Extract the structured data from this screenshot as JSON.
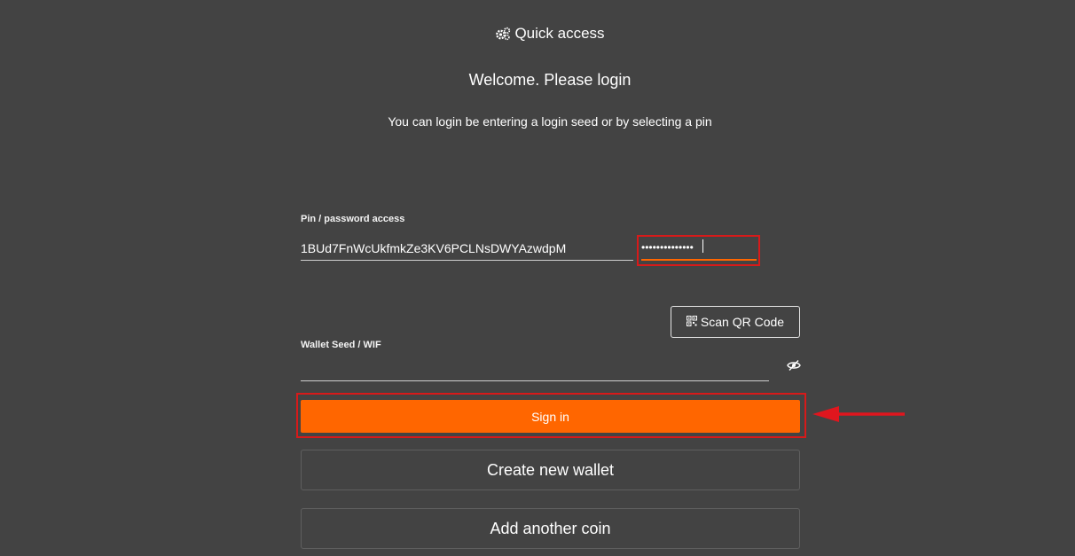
{
  "header": {
    "title": "Quick access",
    "icon": "gears-icon"
  },
  "welcome": "Welcome. Please login",
  "subtitle": "You can login be entering a login seed or by selecting a pin",
  "pin_section": {
    "label": "Pin / password access",
    "address_value": "1BUd7FnWcUkfmkZe3KV6PCLNsDWYAzwdpM",
    "pin_masked": "••••••••••••••"
  },
  "scan_button": {
    "label": "Scan QR Code",
    "icon": "qr-code-icon"
  },
  "seed_section": {
    "label": "Wallet Seed / WIF",
    "value": "",
    "toggle_icon": "eye-slash-icon"
  },
  "buttons": {
    "sign_in": "Sign in",
    "create_wallet": "Create new wallet",
    "add_coin": "Add another coin"
  },
  "colors": {
    "background": "#434343",
    "accent": "#ff6600",
    "highlight": "#d71a1a"
  }
}
